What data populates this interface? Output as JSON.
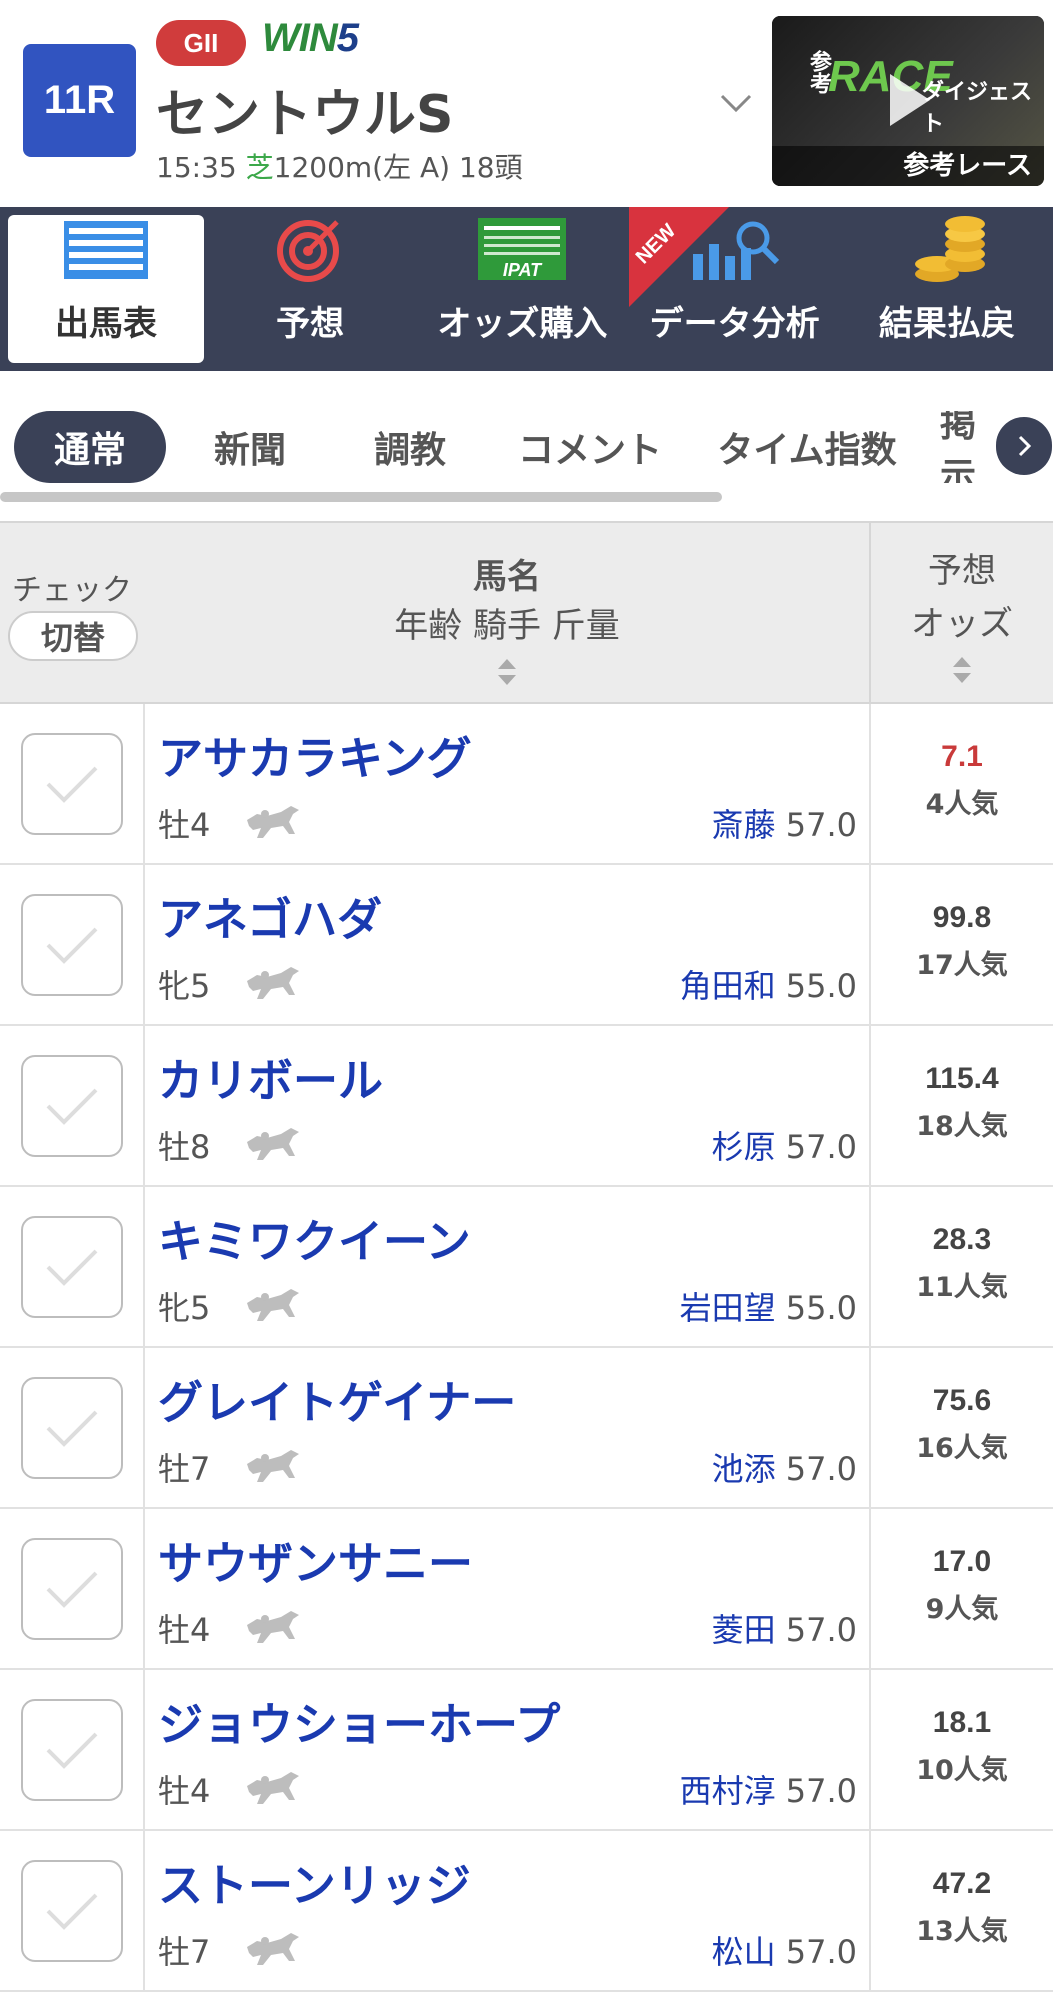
{
  "race": {
    "number": "11R",
    "grade": "GII",
    "win5_a": "WIN",
    "win5_b": "5",
    "name": "セントウルS",
    "time": "15:35",
    "surface": "芝",
    "course": "1200m(左 A) 18頭"
  },
  "digest": {
    "ref_label": "参考",
    "race_label": "RACE",
    "digest_label": "ダイジェスト",
    "caption": "参考レース"
  },
  "nav": {
    "items": [
      {
        "label": "出馬表",
        "icon": "entry-table-icon"
      },
      {
        "label": "予想",
        "icon": "target-icon"
      },
      {
        "label": "オッズ購入",
        "icon": "ipat-icon"
      },
      {
        "label": "データ分析",
        "icon": "data-analysis-icon"
      },
      {
        "label": "結果払戻",
        "icon": "coins-icon"
      }
    ],
    "new_badge": "NEW",
    "colors": {
      "bg": "#3a4157",
      "accent_red": "#d8333e"
    }
  },
  "tabs": {
    "items": [
      "通常",
      "新聞",
      "調教",
      "コメント",
      "タイム指数",
      "掲示"
    ],
    "active": "通常"
  },
  "table": {
    "header": {
      "check": "チェック",
      "toggle": "切替",
      "name": "馬名",
      "subline": "年齢 騎手 斤量",
      "odds_line1": "予想",
      "odds_line2": "オッズ"
    },
    "rows": [
      {
        "horse": "アサカラキング",
        "sexage": "牡4",
        "jockey": "斎藤",
        "weight": "57.0",
        "odds": "7.1",
        "pop": "4人気"
      },
      {
        "horse": "アネゴハダ",
        "sexage": "牝5",
        "jockey": "角田和",
        "weight": "55.0",
        "odds": "99.8",
        "pop": "17人気"
      },
      {
        "horse": "カリボール",
        "sexage": "牡8",
        "jockey": "杉原",
        "weight": "57.0",
        "odds": "115.4",
        "pop": "18人気"
      },
      {
        "horse": "キミワクイーン",
        "sexage": "牝5",
        "jockey": "岩田望",
        "weight": "55.0",
        "odds": "28.3",
        "pop": "11人気"
      },
      {
        "horse": "グレイトゲイナー",
        "sexage": "牡7",
        "jockey": "池添",
        "weight": "57.0",
        "odds": "75.6",
        "pop": "16人気"
      },
      {
        "horse": "サウザンサニー",
        "sexage": "牡4",
        "jockey": "菱田",
        "weight": "57.0",
        "odds": "17.0",
        "pop": "9人気"
      },
      {
        "horse": "ジョウショーホープ",
        "sexage": "牡4",
        "jockey": "西村淳",
        "weight": "57.0",
        "odds": "18.1",
        "pop": "10人気"
      },
      {
        "horse": "ストーンリッジ",
        "sexage": "牡7",
        "jockey": "松山",
        "weight": "57.0",
        "odds": "47.2",
        "pop": "13人気"
      }
    ]
  }
}
